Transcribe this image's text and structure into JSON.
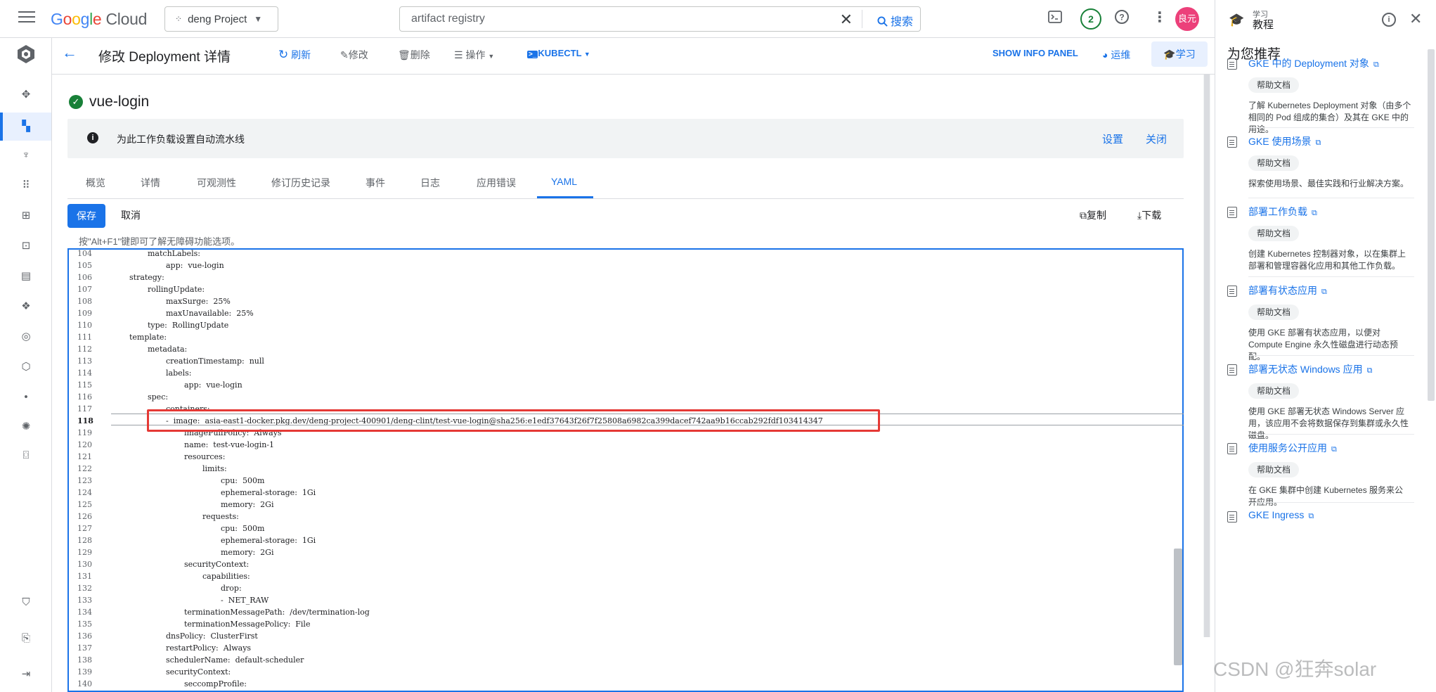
{
  "topbar": {
    "logo_google": "Google",
    "logo_cloud": "Cloud",
    "project": "deng Project",
    "search_value": "artifact registry",
    "search_button": "搜索",
    "notifications_count": "2",
    "avatar_text": "良元"
  },
  "actionbar": {
    "title": "修改 Deployment 详情",
    "refresh": "刷新",
    "edit": "修改",
    "delete": "删除",
    "actions": "操作",
    "kubectl": "KUBECTL",
    "show_info_panel": "SHOW INFO PANEL",
    "ops": "运维",
    "learn": "学习"
  },
  "workload": {
    "name": "vue-login",
    "banner_message": "为此工作负载设置自动流水线",
    "banner_settings": "设置",
    "banner_close": "关闭"
  },
  "tabs": [
    "概览",
    "详情",
    "可观测性",
    "修订历史记录",
    "事件",
    "日志",
    "应用错误",
    "YAML"
  ],
  "editor_toolbar": {
    "save": "保存",
    "cancel": "取消",
    "copy": "复制",
    "download": "下载",
    "hint": "按\"Alt+F1\"键即可了解无障碍功能选项。"
  },
  "yaml_lines": [
    {
      "n": "104",
      "indent": 4,
      "text": "matchLabels:"
    },
    {
      "n": "105",
      "indent": 6,
      "text": "app:  vue-login"
    },
    {
      "n": "106",
      "indent": 2,
      "text": "strategy:"
    },
    {
      "n": "107",
      "indent": 4,
      "text": "rollingUpdate:"
    },
    {
      "n": "108",
      "indent": 6,
      "text": "maxSurge:  25%"
    },
    {
      "n": "109",
      "indent": 6,
      "text": "maxUnavailable:  25%"
    },
    {
      "n": "110",
      "indent": 4,
      "text": "type:  RollingUpdate"
    },
    {
      "n": "111",
      "indent": 2,
      "text": "template:"
    },
    {
      "n": "112",
      "indent": 4,
      "text": "metadata:"
    },
    {
      "n": "113",
      "indent": 6,
      "text": "creationTimestamp:  null"
    },
    {
      "n": "114",
      "indent": 6,
      "text": "labels:"
    },
    {
      "n": "115",
      "indent": 8,
      "text": "app:  vue-login"
    },
    {
      "n": "116",
      "indent": 4,
      "text": "spec:"
    },
    {
      "n": "117",
      "indent": 6,
      "text": "containers:"
    },
    {
      "n": "118",
      "indent": 6,
      "text": "-  image:  asia-east1-docker.pkg.dev/deng-project-400901/deng-clint/test-vue-login@sha256:e1edf37643f26f7f25808a6982ca399dacef742aa9b16ccab292fdf103414347"
    },
    {
      "n": "119",
      "indent": 8,
      "text": "imagePullPolicy:  Always"
    },
    {
      "n": "120",
      "indent": 8,
      "text": "name:  test-vue-login-1"
    },
    {
      "n": "121",
      "indent": 8,
      "text": "resources:"
    },
    {
      "n": "122",
      "indent": 10,
      "text": "limits:"
    },
    {
      "n": "123",
      "indent": 12,
      "text": "cpu:  500m"
    },
    {
      "n": "124",
      "indent": 12,
      "text": "ephemeral-storage:  1Gi"
    },
    {
      "n": "125",
      "indent": 12,
      "text": "memory:  2Gi"
    },
    {
      "n": "126",
      "indent": 10,
      "text": "requests:"
    },
    {
      "n": "127",
      "indent": 12,
      "text": "cpu:  500m"
    },
    {
      "n": "128",
      "indent": 12,
      "text": "ephemeral-storage:  1Gi"
    },
    {
      "n": "129",
      "indent": 12,
      "text": "memory:  2Gi"
    },
    {
      "n": "130",
      "indent": 8,
      "text": "securityContext:"
    },
    {
      "n": "131",
      "indent": 10,
      "text": "capabilities:"
    },
    {
      "n": "132",
      "indent": 12,
      "text": "drop:"
    },
    {
      "n": "133",
      "indent": 12,
      "text": "-  NET_RAW"
    },
    {
      "n": "134",
      "indent": 8,
      "text": "terminationMessagePath:  /dev/termination-log"
    },
    {
      "n": "135",
      "indent": 8,
      "text": "terminationMessagePolicy:  File"
    },
    {
      "n": "136",
      "indent": 6,
      "text": "dnsPolicy:  ClusterFirst"
    },
    {
      "n": "137",
      "indent": 6,
      "text": "restartPolicy:  Always"
    },
    {
      "n": "138",
      "indent": 6,
      "text": "schedulerName:  default-scheduler"
    },
    {
      "n": "139",
      "indent": 6,
      "text": "securityContext:"
    },
    {
      "n": "140",
      "indent": 8,
      "text": "seccompProfile:"
    }
  ],
  "current_line": "118",
  "right_panel": {
    "head_small": "学习",
    "head_title": "教程",
    "section_title": "为您推荐",
    "chip_label": "帮助文档",
    "cards": [
      {
        "title": "GKE 中的 Deployment 对象",
        "desc": "了解 Kubernetes Deployment 对象（由多个相同的 Pod 组成的集合）及其在 GKE 中的用途。"
      },
      {
        "title": "GKE 使用场景",
        "desc": "探索使用场景、最佳实践和行业解决方案。"
      },
      {
        "title": "部署工作负载",
        "desc": "创建 Kubernetes 控制器对象，以在集群上部署和管理容器化应用和其他工作负载。"
      },
      {
        "title": "部署有状态应用",
        "desc": "使用 GKE 部署有状态应用，以便对 Compute Engine 永久性磁盘进行动态预配。"
      },
      {
        "title": "部署无状态 Windows 应用",
        "desc": "使用 GKE 部署无状态 Windows Server 应用，该应用不会将数据保存到集群或永久性磁盘。"
      },
      {
        "title": "使用服务公开应用",
        "desc": "在 GKE 集群中创建 Kubernetes 服务来公开应用。"
      },
      {
        "title": "GKE Ingress",
        "desc": ""
      }
    ]
  },
  "watermark": "CSDN @狂奔solar",
  "colors": {
    "accent": "#1a73e8",
    "success": "#188038",
    "highlight": "#e53935",
    "avatar": "#ec407a"
  }
}
